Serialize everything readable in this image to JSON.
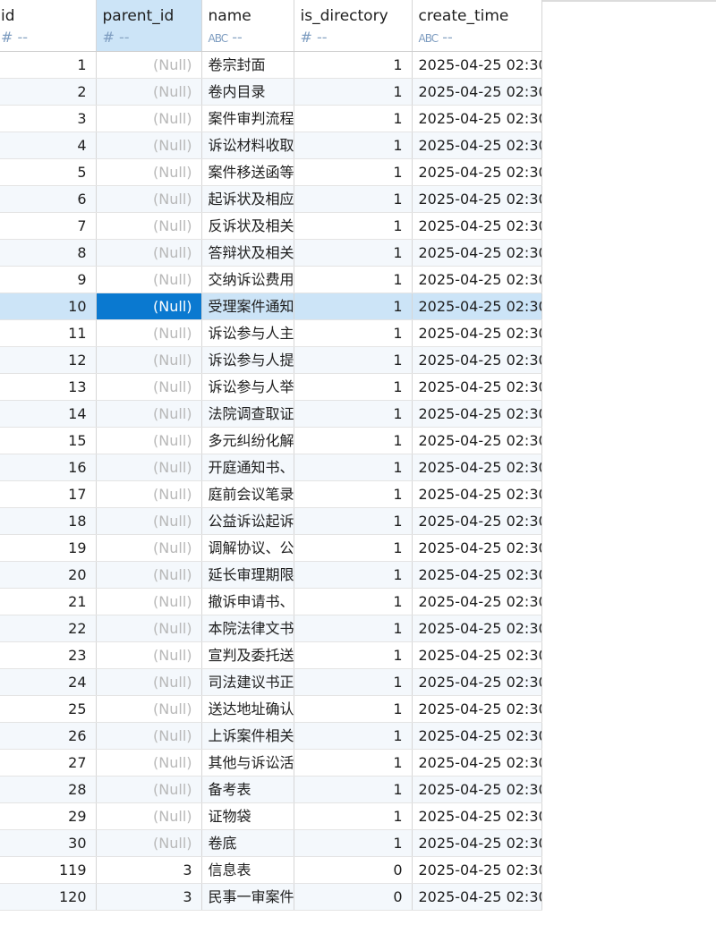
{
  "columns": [
    {
      "name": "id",
      "type_icon": "#",
      "type_text": "--"
    },
    {
      "name": "parent_id",
      "type_icon": "#",
      "type_text": "--"
    },
    {
      "name": "name",
      "type_icon": "ABC",
      "type_text": "--"
    },
    {
      "name": "is_directory",
      "type_icon": "#",
      "type_text": "--"
    },
    {
      "name": "create_time",
      "type_icon": "ABC",
      "type_text": "--"
    }
  ],
  "selected_column": "parent_id",
  "selected_row_index": 9,
  "rows": [
    {
      "id": "1",
      "parent_id": "(Null)",
      "name": "卷宗封面",
      "is_directory": "1",
      "create_time": "2025-04-25 02:30"
    },
    {
      "id": "2",
      "parent_id": "(Null)",
      "name": "卷内目录",
      "is_directory": "1",
      "create_time": "2025-04-25 02:30"
    },
    {
      "id": "3",
      "parent_id": "(Null)",
      "name": "案件审判流程",
      "is_directory": "1",
      "create_time": "2025-04-25 02:30"
    },
    {
      "id": "4",
      "parent_id": "(Null)",
      "name": "诉讼材料收取",
      "is_directory": "1",
      "create_time": "2025-04-25 02:30"
    },
    {
      "id": "5",
      "parent_id": "(Null)",
      "name": "案件移送函等",
      "is_directory": "1",
      "create_time": "2025-04-25 02:30"
    },
    {
      "id": "6",
      "parent_id": "(Null)",
      "name": "起诉状及相应",
      "is_directory": "1",
      "create_time": "2025-04-25 02:30"
    },
    {
      "id": "7",
      "parent_id": "(Null)",
      "name": "反诉状及相关",
      "is_directory": "1",
      "create_time": "2025-04-25 02:30"
    },
    {
      "id": "8",
      "parent_id": "(Null)",
      "name": "答辩状及相关",
      "is_directory": "1",
      "create_time": "2025-04-25 02:30"
    },
    {
      "id": "9",
      "parent_id": "(Null)",
      "name": "交纳诉讼费用",
      "is_directory": "1",
      "create_time": "2025-04-25 02:30"
    },
    {
      "id": "10",
      "parent_id": "(Null)",
      "name": "受理案件通知",
      "is_directory": "1",
      "create_time": "2025-04-25 02:30"
    },
    {
      "id": "11",
      "parent_id": "(Null)",
      "name": "诉讼参与人主",
      "is_directory": "1",
      "create_time": "2025-04-25 02:30"
    },
    {
      "id": "12",
      "parent_id": "(Null)",
      "name": "诉讼参与人提",
      "is_directory": "1",
      "create_time": "2025-04-25 02:30"
    },
    {
      "id": "13",
      "parent_id": "(Null)",
      "name": "诉讼参与人举",
      "is_directory": "1",
      "create_time": "2025-04-25 02:30"
    },
    {
      "id": "14",
      "parent_id": "(Null)",
      "name": "法院调查取证",
      "is_directory": "1",
      "create_time": "2025-04-25 02:30"
    },
    {
      "id": "15",
      "parent_id": "(Null)",
      "name": "多元纠纷化解",
      "is_directory": "1",
      "create_time": "2025-04-25 02:30"
    },
    {
      "id": "16",
      "parent_id": "(Null)",
      "name": "开庭通知书、",
      "is_directory": "1",
      "create_time": "2025-04-25 02:30"
    },
    {
      "id": "17",
      "parent_id": "(Null)",
      "name": "庭前会议笔录",
      "is_directory": "1",
      "create_time": "2025-04-25 02:30"
    },
    {
      "id": "18",
      "parent_id": "(Null)",
      "name": "公益诉讼起诉",
      "is_directory": "1",
      "create_time": "2025-04-25 02:30"
    },
    {
      "id": "19",
      "parent_id": "(Null)",
      "name": "调解协议、公",
      "is_directory": "1",
      "create_time": "2025-04-25 02:30"
    },
    {
      "id": "20",
      "parent_id": "(Null)",
      "name": "延长审理期限",
      "is_directory": "1",
      "create_time": "2025-04-25 02:30"
    },
    {
      "id": "21",
      "parent_id": "(Null)",
      "name": "撤诉申请书、",
      "is_directory": "1",
      "create_time": "2025-04-25 02:30"
    },
    {
      "id": "22",
      "parent_id": "(Null)",
      "name": "本院法律文书",
      "is_directory": "1",
      "create_time": "2025-04-25 02:30"
    },
    {
      "id": "23",
      "parent_id": "(Null)",
      "name": "宣判及委托送",
      "is_directory": "1",
      "create_time": "2025-04-25 02:30"
    },
    {
      "id": "24",
      "parent_id": "(Null)",
      "name": "司法建议书正",
      "is_directory": "1",
      "create_time": "2025-04-25 02:30"
    },
    {
      "id": "25",
      "parent_id": "(Null)",
      "name": "送达地址确认",
      "is_directory": "1",
      "create_time": "2025-04-25 02:30"
    },
    {
      "id": "26",
      "parent_id": "(Null)",
      "name": "上诉案件相关",
      "is_directory": "1",
      "create_time": "2025-04-25 02:30"
    },
    {
      "id": "27",
      "parent_id": "(Null)",
      "name": "其他与诉讼活",
      "is_directory": "1",
      "create_time": "2025-04-25 02:30"
    },
    {
      "id": "28",
      "parent_id": "(Null)",
      "name": "备考表",
      "is_directory": "1",
      "create_time": "2025-04-25 02:30"
    },
    {
      "id": "29",
      "parent_id": "(Null)",
      "name": "证物袋",
      "is_directory": "1",
      "create_time": "2025-04-25 02:30"
    },
    {
      "id": "30",
      "parent_id": "(Null)",
      "name": "卷底",
      "is_directory": "1",
      "create_time": "2025-04-25 02:30"
    },
    {
      "id": "119",
      "parent_id": "3",
      "name": "信息表",
      "is_directory": "0",
      "create_time": "2025-04-25 02:30"
    },
    {
      "id": "120",
      "parent_id": "3",
      "name": "民事一审案件",
      "is_directory": "0",
      "create_time": "2025-04-25 02:30"
    }
  ]
}
